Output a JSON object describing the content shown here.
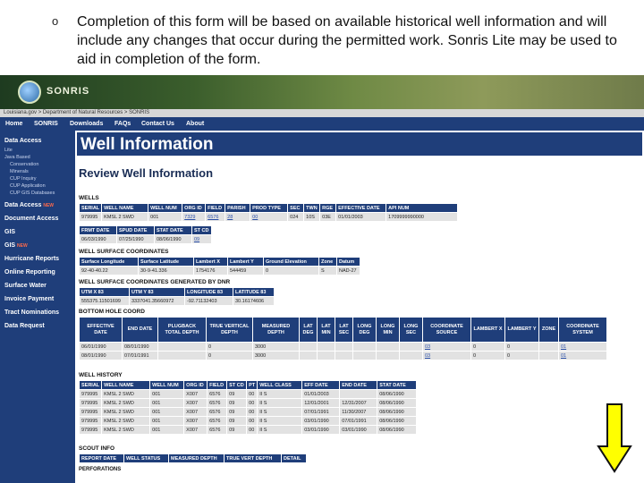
{
  "bullet": {
    "marker": "o",
    "text": "Completion of this form will be based on available historical well information and will include any changes that occur during the permitted work. Sonris Lite may be used to aid in completion of the form."
  },
  "banner": {
    "logo_text": "SONRIS"
  },
  "breadcrumb": "Louisiana.gov > Department of Natural Resources > SONRIS",
  "topnav": [
    "Home",
    "SONRIS",
    "Downloads",
    "FAQs",
    "Contact Us",
    "About"
  ],
  "sidebar": {
    "data_access": "Data Access",
    "lite": "Lite",
    "java_based": "Java Based",
    "sub_items": [
      "Conservation",
      "Minerals",
      "CUP Inquiry",
      "CUP Application",
      "CUP GIS Databases"
    ],
    "links": [
      {
        "label": "Data Access",
        "badge": "NEW"
      },
      {
        "label": "Document Access",
        "badge": ""
      },
      {
        "label": "GIS",
        "badge": ""
      },
      {
        "label": "GIS",
        "badge": "NEW"
      },
      {
        "label": "Hurricane Reports",
        "badge": ""
      },
      {
        "label": "Online Reporting",
        "badge": ""
      },
      {
        "label": "Surface Water",
        "badge": ""
      },
      {
        "label": "Invoice Payment",
        "badge": ""
      },
      {
        "label": "Tract Nominations",
        "badge": ""
      },
      {
        "label": "Data Request",
        "badge": ""
      }
    ]
  },
  "page": {
    "title": "Well Information",
    "subtitle": "Review Well Information"
  },
  "wells": {
    "label": "WELLS",
    "headers": [
      "SERIAL",
      "WELL NAME",
      "WELL NUM",
      "ORG ID",
      "FIELD",
      "PARISH",
      "PROD TYPE",
      "SEC",
      "TWN",
      "RGE",
      "EFFECTIVE DATE",
      "API NUM"
    ],
    "row": [
      "979995",
      "KMSL 2 SWD",
      "001",
      "7329",
      "6576",
      "28",
      "00",
      "024",
      "10S",
      "03E",
      "01/01/2003",
      "1709999990000"
    ],
    "link_cols": [
      3,
      4,
      5,
      6
    ]
  },
  "dates": {
    "headers": [
      "FRMT DATE",
      "SPUD DATE",
      "STAT DATE",
      "ST CD"
    ],
    "row": [
      "06/03/1990",
      "07/25/1990",
      "08/06/1990",
      "09"
    ],
    "link_cols": [
      3
    ]
  },
  "surface_coords": {
    "label": "WELL SURFACE COORDINATES",
    "headers": [
      "Surface Longitude",
      "Surface Latitude",
      "Lambert X",
      "Lambert Y",
      "Ground Elevation",
      "Zone",
      "Datum"
    ],
    "row": [
      "92-40-40.22",
      "30-9-41.336",
      "1754176",
      "544459",
      "0",
      "S",
      "NAD-27"
    ]
  },
  "dnr_coords": {
    "label": "WELL SURFACE COORDINATES GENERATED BY DNR",
    "headers": [
      "UTM X 83",
      "UTM Y 83",
      "LONGITUDE 83",
      "LATITUDE 83"
    ],
    "row": [
      "555375.11501699",
      "3337041.35660972",
      "-92.71132403",
      "30.16174606"
    ]
  },
  "bottom_hole": {
    "label": "BOTTOM HOLE COORD",
    "headers": [
      "EFFECTIVE DATE",
      "END DATE",
      "PLUGBACK TOTAL DEPTH",
      "TRUE VERTICAL DEPTH",
      "MEASURED DEPTH",
      "LAT DEG",
      "LAT MIN",
      "LAT SEC",
      "LONG DEG",
      "LONG MIN",
      "LONG SEC",
      "COORDINATE SOURCE",
      "LAMBERT X",
      "LAMBERT Y",
      "ZONE",
      "COORDINATE SYSTEM"
    ],
    "rows": [
      [
        "06/01/1990",
        "08/01/1990",
        "",
        "0",
        "3000",
        "",
        "",
        "",
        "",
        "",
        "",
        "03",
        "0",
        "0",
        "",
        "01"
      ],
      [
        "08/01/1990",
        "07/01/1991",
        "",
        "0",
        "3000",
        "",
        "",
        "",
        "",
        "",
        "",
        "03",
        "0",
        "0",
        "",
        "01"
      ]
    ],
    "link_cols": [
      11,
      15
    ]
  },
  "history": {
    "label": "WELL HISTORY",
    "headers": [
      "SERIAL",
      "WELL NAME",
      "WELL NUM",
      "ORG ID",
      "FIELD",
      "ST CD",
      "PT",
      "WELL CLASS",
      "EFF DATE",
      "END DATE",
      "STAT DATE"
    ],
    "rows": [
      [
        "979995",
        "KMSL 2 SWD",
        "001",
        "X007",
        "6576",
        "09",
        "00",
        "II S",
        "01/01/2003",
        "",
        "08/06/1990"
      ],
      [
        "979995",
        "KMSL 2 SWD",
        "001",
        "X007",
        "6576",
        "09",
        "00",
        "II S",
        "12/01/2001",
        "12/31/2007",
        "08/06/1990"
      ],
      [
        "979995",
        "KMSL 2 SWD",
        "001",
        "X007",
        "6576",
        "09",
        "00",
        "II S",
        "07/01/1991",
        "11/30/2007",
        "08/06/1990"
      ],
      [
        "979995",
        "KMSL 2 SWD",
        "001",
        "X007",
        "6576",
        "09",
        "00",
        "II S",
        "03/01/1990",
        "07/01/1991",
        "08/06/1990"
      ],
      [
        "979995",
        "KMSL 2 SWD",
        "001",
        "X007",
        "6576",
        "09",
        "00",
        "II S",
        "03/01/1990",
        "03/01/1990",
        "08/06/1990"
      ]
    ]
  },
  "scout": {
    "label": "SCOUT INFO",
    "headers": [
      "REPORT DATE",
      "WELL STATUS",
      "MEASURED DEPTH",
      "TRUE VERT DEPTH",
      "DETAIL"
    ]
  },
  "perforations_label": "PERFORATIONS",
  "colors": {
    "nav_blue": "#1f3e7a",
    "cell_gray": "#e2e2e2",
    "arrow_yellow": "#ffff00"
  }
}
